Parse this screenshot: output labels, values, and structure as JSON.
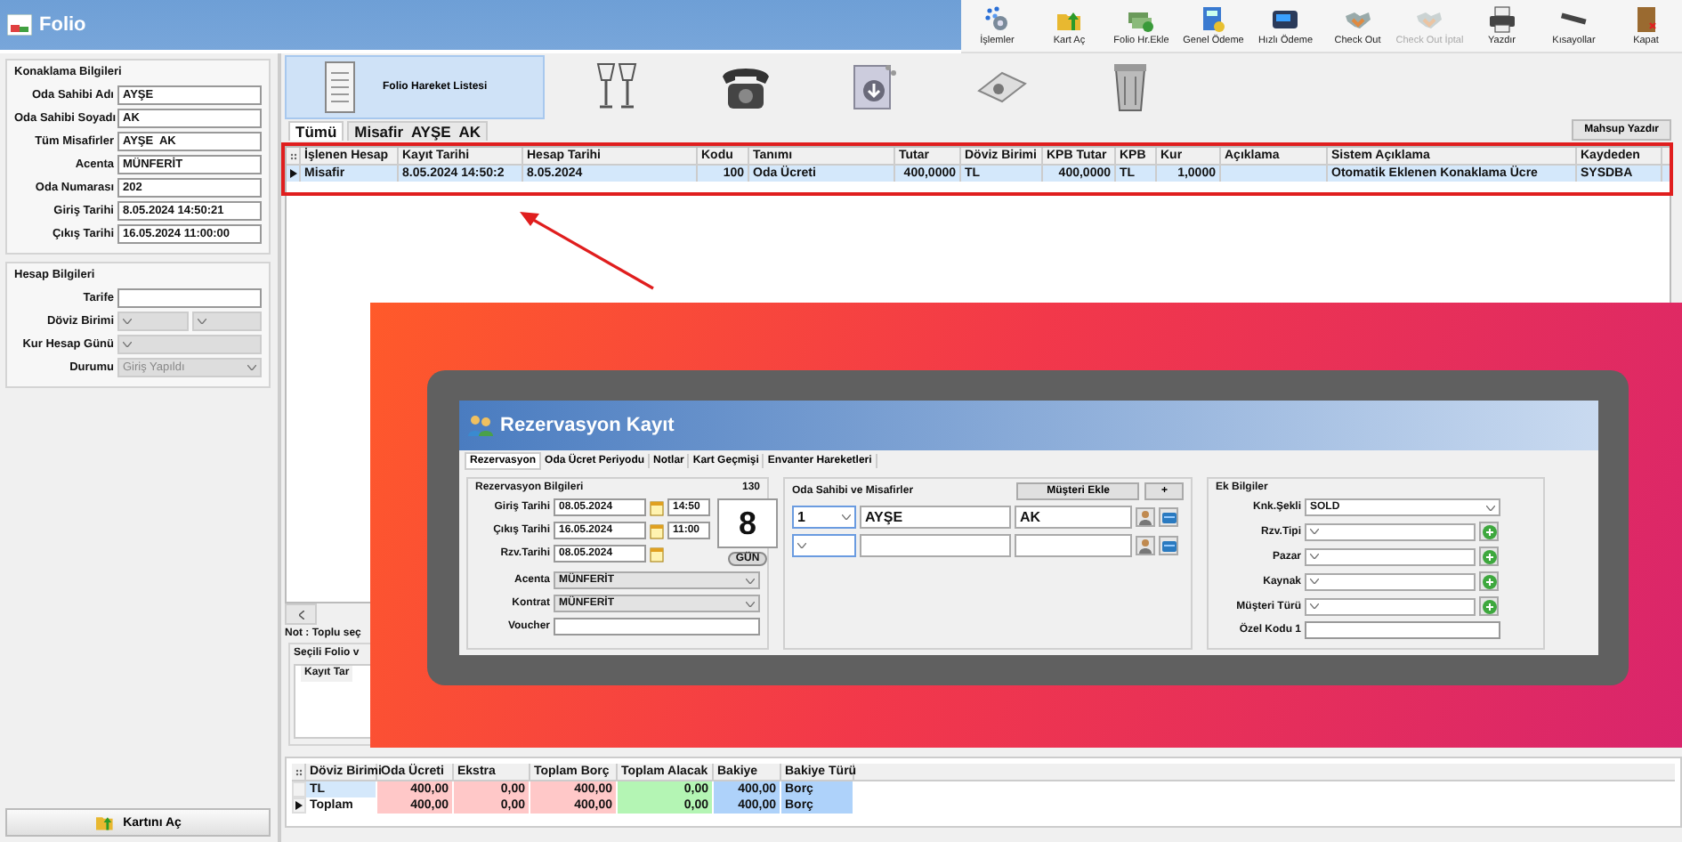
{
  "window": {
    "title": "Folio"
  },
  "toolbar": [
    {
      "label": "İşlemler",
      "kind": "gear",
      "disabled": false
    },
    {
      "label": "Kart Aç",
      "kind": "folder",
      "disabled": false
    },
    {
      "label": "Folio Hr.Ekle",
      "kind": "banknote",
      "disabled": false
    },
    {
      "label": "Genel Ödeme",
      "kind": "document",
      "disabled": false
    },
    {
      "label": "Hızlı Ödeme",
      "kind": "card-reader",
      "disabled": false
    },
    {
      "label": "Check Out",
      "kind": "handshake",
      "disabled": false
    },
    {
      "label": "Check Out İptal",
      "kind": "handshake",
      "disabled": true
    },
    {
      "label": "Yazdır",
      "kind": "printer",
      "disabled": false
    },
    {
      "label": "Kısayollar",
      "kind": "keyboard",
      "disabled": false
    },
    {
      "label": "Kapat",
      "kind": "door",
      "disabled": false
    }
  ],
  "stay_info": {
    "title": "Konaklama Bilgileri",
    "fields": [
      {
        "label": "Oda Sahibi Adı",
        "value": "AYŞE"
      },
      {
        "label": "Oda Sahibi Soyadı",
        "value": "AK"
      },
      {
        "label": "Tüm Misafirler",
        "value": "AYŞE  AK"
      },
      {
        "label": "Acenta",
        "value": "MÜNFERİT"
      },
      {
        "label": "Oda Numarası",
        "value": "202"
      },
      {
        "label": "Giriş Tarihi",
        "value": "8.05.2024 14:50:21"
      },
      {
        "label": "Çıkış Tarihi",
        "value": "16.05.2024 11:00:00"
      }
    ]
  },
  "account_info": {
    "title": "Hesap Bilgileri",
    "fields": [
      {
        "label": "Tarife",
        "kind": "text",
        "disabled": false
      },
      {
        "label": "Döviz Birimi",
        "kind": "double-select",
        "disabled": true
      },
      {
        "label": "Kur Hesap Günü",
        "kind": "select",
        "disabled": true
      },
      {
        "label": "Durumu",
        "kind": "select",
        "value": "Giriş Yapıldı",
        "disabled": true
      }
    ]
  },
  "open_card_button": {
    "label": "Kartını Aç"
  },
  "view_buttons": [
    {
      "kind": "list",
      "label": "Folio Hareket Listesi",
      "selected": true
    },
    {
      "kind": "glasses",
      "selected": false
    },
    {
      "kind": "phone",
      "selected": false
    },
    {
      "kind": "download",
      "selected": false
    },
    {
      "kind": "cash",
      "selected": false
    },
    {
      "kind": "trash",
      "selected": false
    }
  ],
  "folio_tabs": [
    {
      "label": "Tümü",
      "selected": true
    },
    {
      "label": "Misafir  AYŞE  AK",
      "selected": false
    }
  ],
  "print_button": {
    "label": "Mahsup Yazdır"
  },
  "transactions": {
    "columns": [
      "İşlenen Hesap",
      "Kayıt Tarihi",
      "Hesap Tarihi",
      "Kodu",
      "Tanımı",
      "Tutar",
      "Döviz Birimi",
      "KPB Tutar",
      "KPB",
      "Kur",
      "Açıklama",
      "Sistem Açıklama",
      "Kaydeden"
    ],
    "rows": [
      {
        "selected": true,
        "cells": [
          "Misafir",
          "8.05.2024 14:50:2",
          "8.05.2024",
          "100",
          "Oda Ücreti",
          "400,0000",
          "TL",
          "400,0000",
          "TL",
          "1,0000",
          null,
          "Otomatik Eklenen Konaklama Ücre",
          "SYSDBA"
        ]
      }
    ]
  },
  "note": "Not : Toplu seç",
  "selected_folio": {
    "title": "Seçili Folio v",
    "columns": [
      "Kayıt Tar"
    ]
  },
  "summary": {
    "columns": [
      {
        "label": "Döviz Birimi"
      },
      {
        "label": "Oda Ücreti",
        "color": "#ffc8c8"
      },
      {
        "label": "Ekstra",
        "color": "#ffc8c8"
      },
      {
        "label": "Toplam Borç",
        "color": "#ffc8c8"
      },
      {
        "label": "Toplam Alacak",
        "color": "#b4f5b4"
      },
      {
        "label": "Bakiye",
        "color": "#aed2fa"
      },
      {
        "label": "Bakiye Türü",
        "color": "#aed2fa"
      }
    ],
    "rows": [
      {
        "selected": true,
        "current": false,
        "cells": [
          "TL",
          "400,00",
          "0,00",
          "400,00",
          "0,00",
          "400,00",
          "Borç"
        ]
      },
      {
        "selected": false,
        "current": true,
        "cells": [
          "Toplam",
          "400,00",
          "0,00",
          "400,00",
          "0,00",
          "400,00",
          "Borç"
        ]
      }
    ]
  },
  "reservation_window": {
    "title": "Rezervasyon Kayıt",
    "tabs": [
      {
        "label": "Rezervasyon",
        "selected": true
      },
      {
        "label": "Oda Ücret Periyodu",
        "selected": false
      },
      {
        "label": "Notlar",
        "selected": false
      },
      {
        "label": "Kart Geçmişi",
        "selected": false
      },
      {
        "label": "Envanter Hareketleri",
        "selected": false
      }
    ],
    "reservation_info": {
      "title": "Rezervasyon Bilgileri",
      "number": "130",
      "dates": [
        {
          "label": "Giriş Tarihi",
          "date": "08.05.2024",
          "time": "14:50"
        },
        {
          "label": "Çıkış Tarihi",
          "date": "16.05.2024",
          "time": "11:00"
        },
        {
          "label": "Rzv.Tarihi",
          "date": "08.05.2024"
        }
      ],
      "nights": "8",
      "nights_unit": "GÜN",
      "fields": [
        {
          "label": "Acenta",
          "kind": "select",
          "value": "MÜNFERİT"
        },
        {
          "label": "Kontrat",
          "kind": "select",
          "value": "MÜNFERİT"
        },
        {
          "label": "Voucher",
          "kind": "text"
        }
      ]
    },
    "guests": {
      "title": "Oda Sahibi ve Misafirler",
      "add_button": "Müşteri Ekle",
      "plus_button": "+",
      "rows": [
        {
          "number": "1",
          "first_name": "AYŞE",
          "last_name": "AK"
        },
        {
          "number": null,
          "first_name": null,
          "last_name": null
        }
      ]
    },
    "extra_info": {
      "title": "Ek Bilgiler",
      "fields": [
        {
          "label": "Knk.Şekli",
          "kind": "select",
          "value": "SOLD"
        },
        {
          "label": "Rzv.Tipi",
          "kind": "select-add"
        },
        {
          "label": "Pazar",
          "kind": "select-add"
        },
        {
          "label": "Kaynak",
          "kind": "select-add"
        },
        {
          "label": "Müşteri Türü",
          "kind": "select-add"
        },
        {
          "label": "Özel Kodu 1",
          "kind": "text"
        }
      ]
    }
  }
}
